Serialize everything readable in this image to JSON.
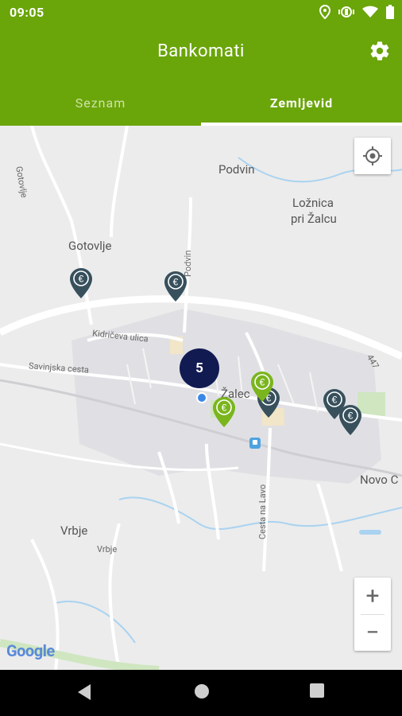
{
  "status_bar": {
    "time": "09:05"
  },
  "app_bar": {
    "title": "Bankomati"
  },
  "tabs": [
    {
      "label": "Seznam",
      "selected": false
    },
    {
      "label": "Zemljevid",
      "selected": true
    }
  ],
  "map": {
    "labels": {
      "podvin_top": "Podvin",
      "loznica": "Ložnica",
      "pri_zalcu": "pri Žalcu",
      "gotovlje": "Gotovlje",
      "gotovlje_road": "Gotovlje",
      "podvin_road": "Podvin",
      "kidriceva": "Kidričeva ulica",
      "savinjska": "Savinjska cesta",
      "zalec": "Žalec",
      "road_447": "447",
      "novo": "Novo C",
      "cesta_na_lavo": "Cesta na Lavo",
      "vrbje": "Vrbje",
      "vrbje_small": "Vrbje"
    },
    "cluster_count": "5",
    "atm_symbol": "€",
    "zoom_in": "+",
    "zoom_out": "−",
    "google_logo": "Google",
    "colors": {
      "pin_dark": "#37505c",
      "pin_green": "#7ab51d",
      "cluster": "#121a52",
      "accent": "#6aa50a"
    }
  }
}
